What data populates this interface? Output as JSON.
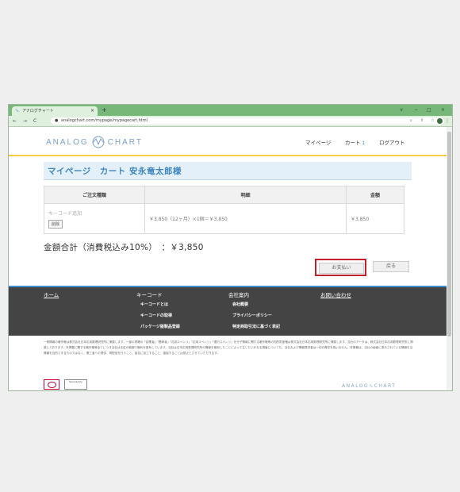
{
  "browser": {
    "tab_title": "アナログチャート",
    "close_glyph": "×",
    "newtab_glyph": "+",
    "url": "analogchart.com/mypage/mypagecart.html",
    "win_min": "∨",
    "win_dash": "−",
    "win_max": "□",
    "win_close": "×"
  },
  "site": {
    "logo_left": "ANALOG",
    "logo_right": "CHART",
    "nav": {
      "mypage": "マイページ",
      "cart": "カート",
      "cart_count": "1",
      "logout": "ログアウト"
    }
  },
  "page": {
    "heading": "マイページ　カート 安永竜太郎様",
    "table": {
      "headers": [
        "ご注文種類",
        "明細",
        "金額"
      ],
      "rows": [
        {
          "type": "キーコード追加",
          "delete_label": "削除",
          "detail": "￥3,850（12ヶ月）×1個＝￥3,850",
          "amount": "￥3,850"
        }
      ]
    },
    "total_label": "金額合計（消費税込み10%）　：￥3,850",
    "pay_button": "お支払い",
    "back_button": "戻る"
  },
  "footer": {
    "home": "ホーム",
    "keycode": "キーコード",
    "keycode_links": [
      "キーコードとは",
      "キーコードの取得",
      "パッケージ版製品登録"
    ],
    "company": "会社案内",
    "company_links": [
      "会社概要",
      "プライバシーポリシー",
      "特定商取引法に基づく表記"
    ],
    "contact": "お問い合わせ"
  },
  "legal": "一般情報の著作権は株式会社日本応用数理研究所に帰属します。一部の書籍の「創業者」「基幹者」「応用スペンリ」「応用スペンリ」「遷行スペンリ」を分子情報に関する著作権等の知的財産権は株式会社日本応用数理研究所に帰属します。当社のデータは、株式会社日本応用数理研究所に帰属しております。本掲載に関する著作権等全てにつき当社は法定の範囲で権利を保有しています。当社は日本応用数理研究所の情報を使用したことによって生じたいかなる損害についても、当社および情報提供者は一切の責任を負いません。本情報は、当社の画面に表示されている情報を当情報を目的とするものではなく、第三者への提供、再配信を行うこと、独自に加工すること、複製することは禁止とさせていただきます。",
  "seal_text": "Secured by"
}
